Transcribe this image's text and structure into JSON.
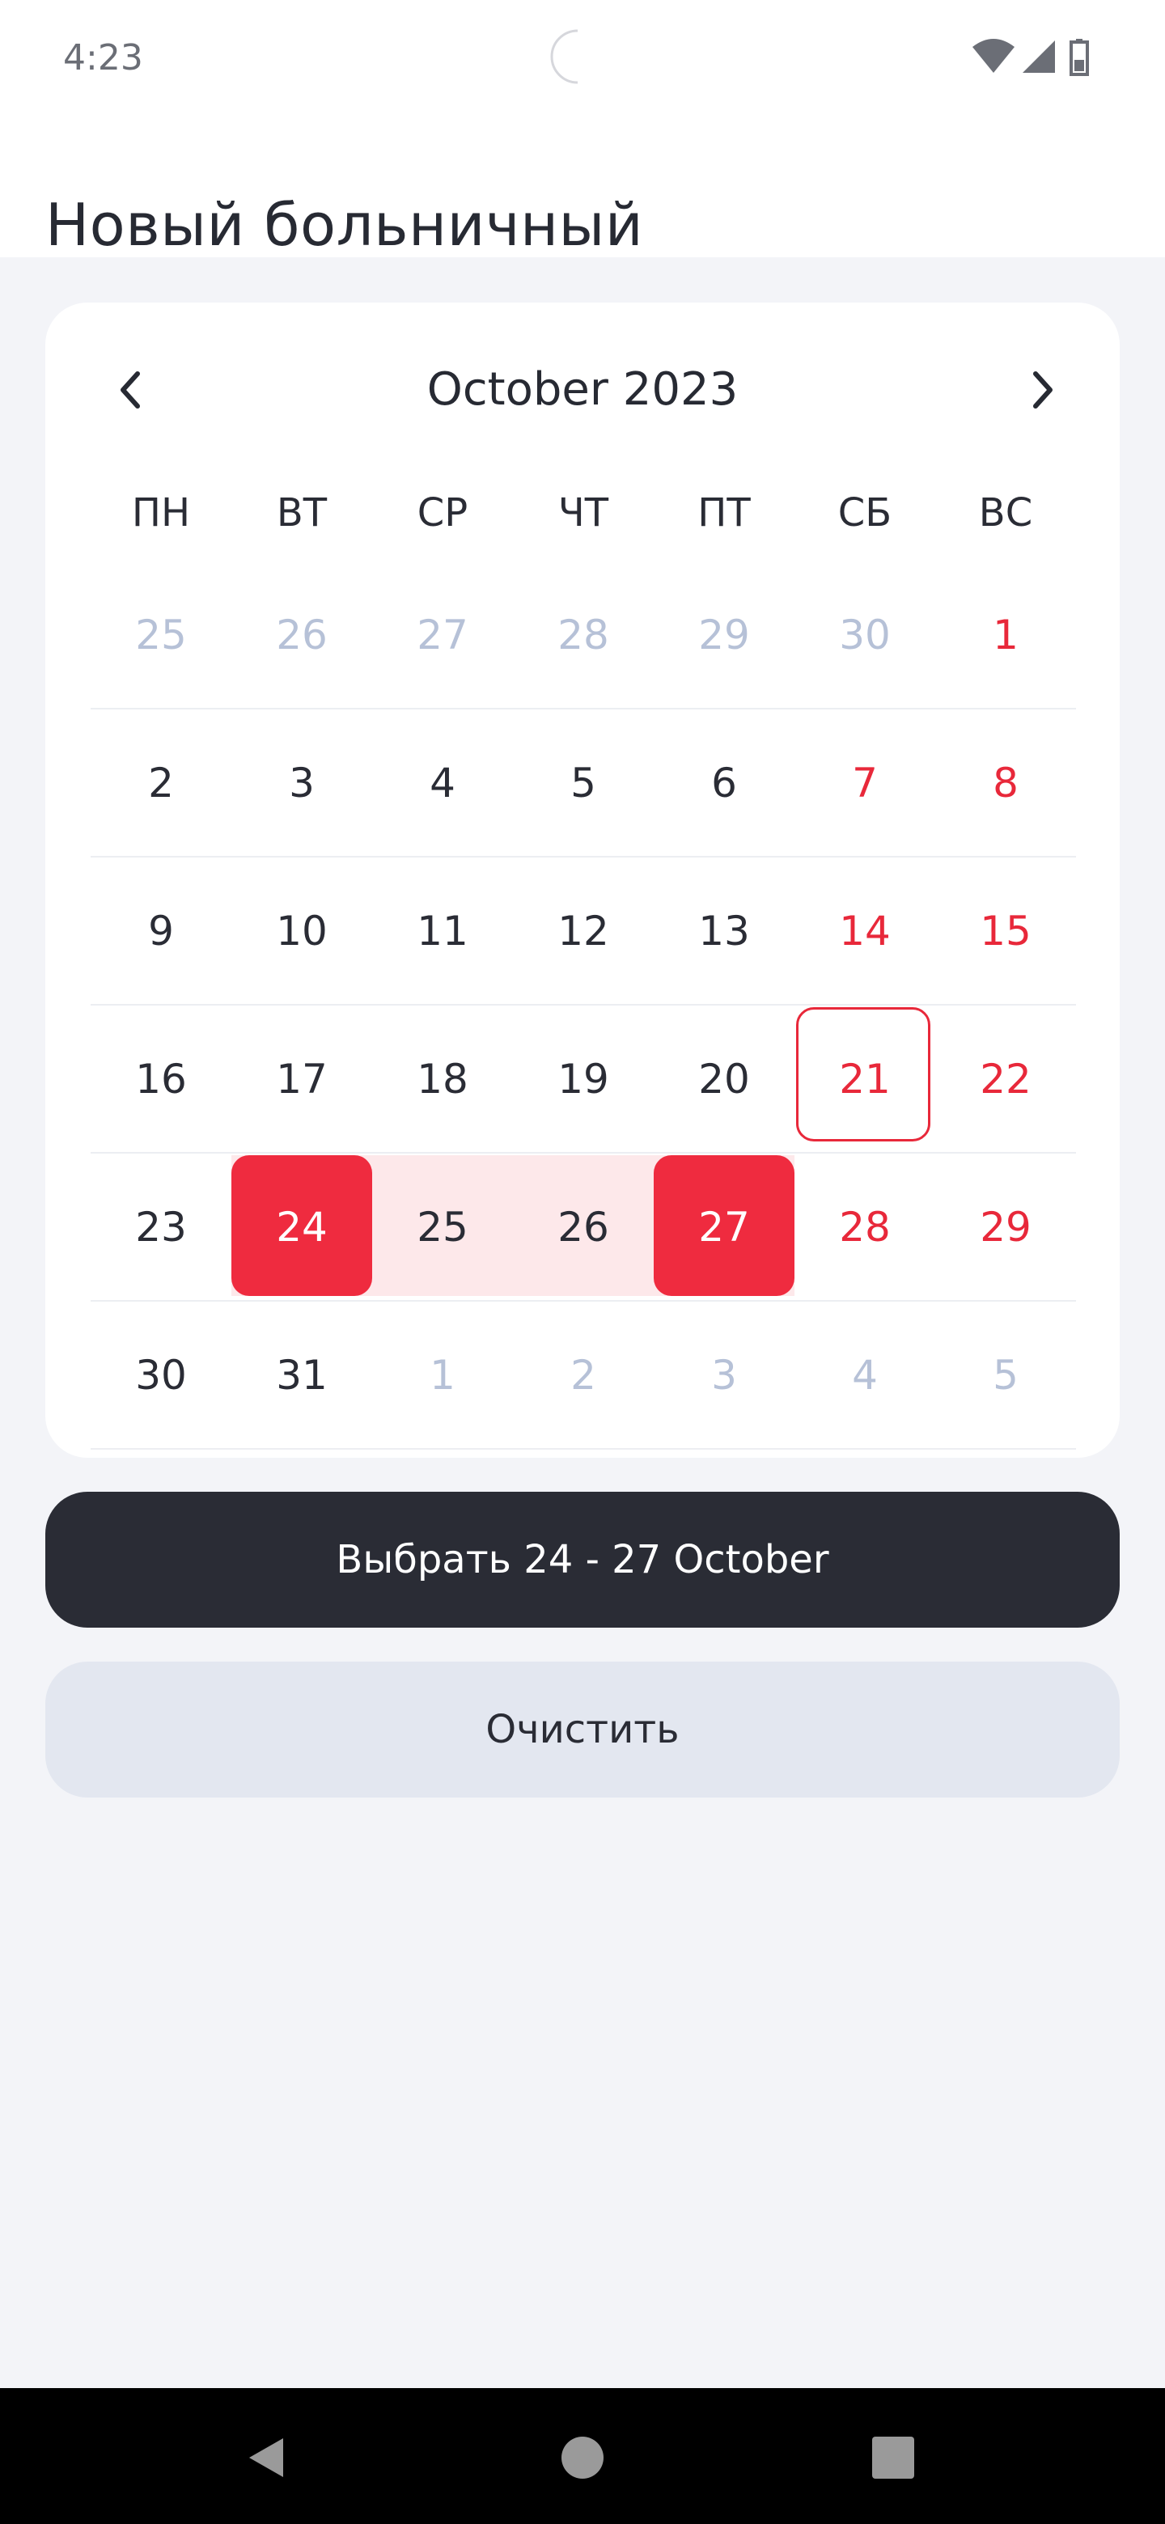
{
  "status_bar": {
    "time": "4:23"
  },
  "header": {
    "title": "Новый больничный"
  },
  "calendar": {
    "month_label": "October 2023",
    "weekdays": [
      "ПН",
      "ВТ",
      "СР",
      "ЧТ",
      "ПТ",
      "СБ",
      "ВС"
    ],
    "weeks": [
      [
        {
          "d": "25",
          "s": "other"
        },
        {
          "d": "26",
          "s": "other"
        },
        {
          "d": "27",
          "s": "other"
        },
        {
          "d": "28",
          "s": "other"
        },
        {
          "d": "29",
          "s": "other"
        },
        {
          "d": "30",
          "s": "other"
        },
        {
          "d": "1",
          "s": "weekend"
        }
      ],
      [
        {
          "d": "2",
          "s": ""
        },
        {
          "d": "3",
          "s": ""
        },
        {
          "d": "4",
          "s": ""
        },
        {
          "d": "5",
          "s": ""
        },
        {
          "d": "6",
          "s": ""
        },
        {
          "d": "7",
          "s": "weekend"
        },
        {
          "d": "8",
          "s": "weekend"
        }
      ],
      [
        {
          "d": "9",
          "s": ""
        },
        {
          "d": "10",
          "s": ""
        },
        {
          "d": "11",
          "s": ""
        },
        {
          "d": "12",
          "s": ""
        },
        {
          "d": "13",
          "s": ""
        },
        {
          "d": "14",
          "s": "weekend"
        },
        {
          "d": "15",
          "s": "weekend"
        }
      ],
      [
        {
          "d": "16",
          "s": ""
        },
        {
          "d": "17",
          "s": ""
        },
        {
          "d": "18",
          "s": ""
        },
        {
          "d": "19",
          "s": ""
        },
        {
          "d": "20",
          "s": ""
        },
        {
          "d": "21",
          "s": "weekend today"
        },
        {
          "d": "22",
          "s": "weekend"
        }
      ],
      [
        {
          "d": "23",
          "s": ""
        },
        {
          "d": "24",
          "s": "sel"
        },
        {
          "d": "25",
          "s": "inrange"
        },
        {
          "d": "26",
          "s": "inrange"
        },
        {
          "d": "27",
          "s": "sel"
        },
        {
          "d": "28",
          "s": "weekend"
        },
        {
          "d": "29",
          "s": "weekend"
        }
      ],
      [
        {
          "d": "30",
          "s": ""
        },
        {
          "d": "31",
          "s": ""
        },
        {
          "d": "1",
          "s": "other"
        },
        {
          "d": "2",
          "s": "other"
        },
        {
          "d": "3",
          "s": "other"
        },
        {
          "d": "4",
          "s": "other"
        },
        {
          "d": "5",
          "s": "other"
        }
      ]
    ],
    "today": "21",
    "selection": {
      "start": "24",
      "end": "27"
    }
  },
  "actions": {
    "select_label": "Выбрать 24 - 27 October",
    "clear_label": "Очистить"
  },
  "colors": {
    "accent": "#ef2b3f",
    "range_fill": "#fde8ea",
    "primary_button": "#2a2c35",
    "secondary_button": "#e3e7f0",
    "muted_day": "#b6c1d7"
  },
  "icons": {
    "prev": "chevron-left-icon",
    "next": "chevron-right-icon",
    "wifi": "wifi-icon",
    "signal": "signal-icon",
    "battery": "battery-icon",
    "back": "nav-back-icon",
    "home": "nav-home-icon",
    "recents": "nav-recents-icon"
  }
}
